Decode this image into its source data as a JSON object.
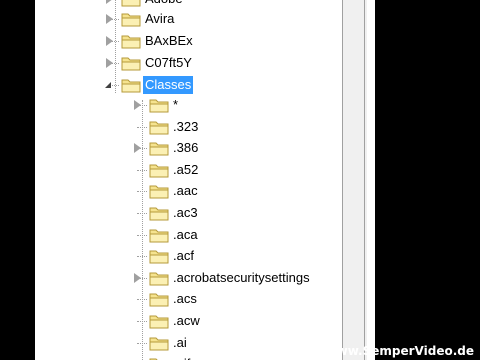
{
  "tree": {
    "parents": [
      {
        "label": "Adobe",
        "expandable": true
      },
      {
        "label": "Avira",
        "expandable": true
      },
      {
        "label": "BAxBEx",
        "expandable": true
      },
      {
        "label": "C07ft5Y",
        "expandable": true
      },
      {
        "label": "Classes",
        "expandable": true,
        "expanded": true,
        "selected": true
      }
    ],
    "children": [
      {
        "label": "*",
        "expandable": true
      },
      {
        "label": ".323",
        "expandable": false
      },
      {
        "label": ".386",
        "expandable": true
      },
      {
        "label": ".a52",
        "expandable": false
      },
      {
        "label": ".aac",
        "expandable": false
      },
      {
        "label": ".ac3",
        "expandable": false
      },
      {
        "label": ".aca",
        "expandable": false
      },
      {
        "label": ".acf",
        "expandable": false
      },
      {
        "label": ".acrobatsecuritysettings",
        "expandable": true
      },
      {
        "label": ".acs",
        "expandable": false
      },
      {
        "label": ".acw",
        "expandable": false
      },
      {
        "label": ".ai",
        "expandable": false
      },
      {
        "label": ".aif",
        "expandable": false
      }
    ]
  },
  "watermark": "www.SemperVideo.de",
  "colors": {
    "selection": "#3399ff",
    "folder": "#f5e38f",
    "folder_edge": "#b59a3a"
  }
}
